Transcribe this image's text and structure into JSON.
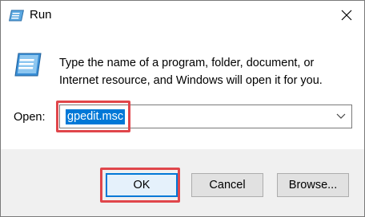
{
  "window": {
    "title": "Run",
    "icon": "run-icon"
  },
  "prompt": {
    "line1": "Type the name of a program, folder, document, or",
    "line2": "Internet resource, and Windows will open it for you."
  },
  "open_field": {
    "label": "Open:",
    "value": "gpedit.msc"
  },
  "buttons": {
    "ok": "OK",
    "cancel": "Cancel",
    "browse": "Browse..."
  },
  "colors": {
    "accent": "#0078d7",
    "highlight": "#e0464b"
  }
}
